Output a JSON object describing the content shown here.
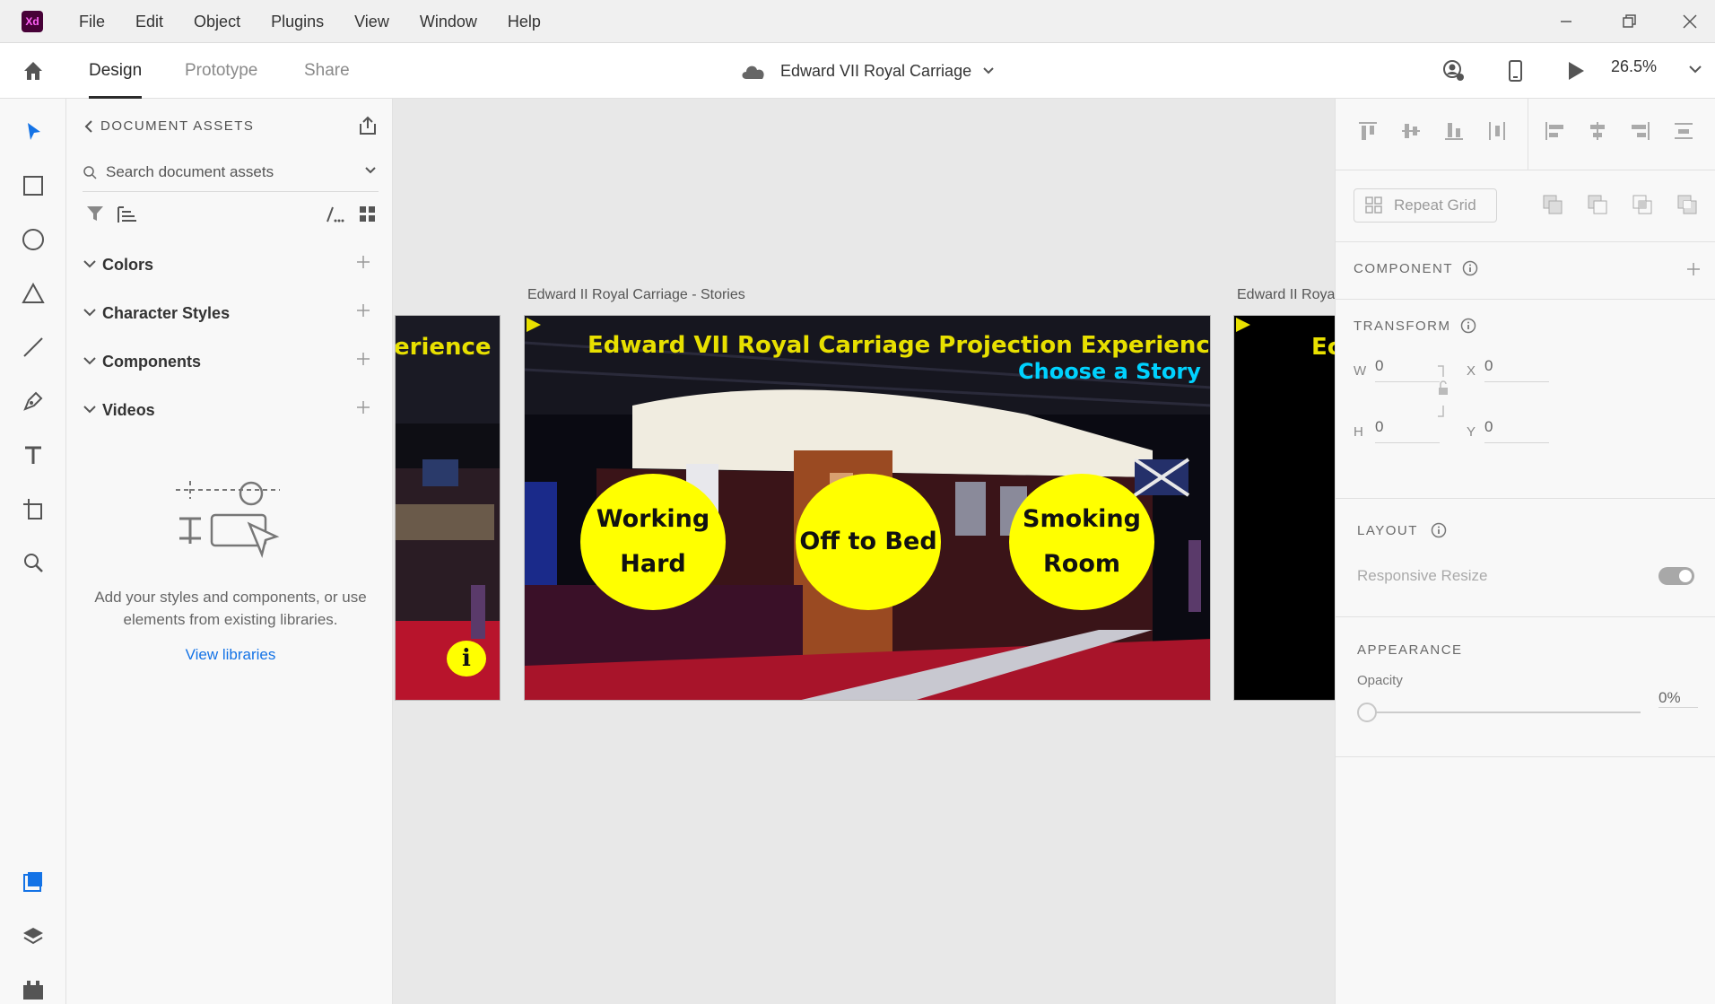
{
  "menu": {
    "app_logo": "Xd",
    "items": [
      "File",
      "Edit",
      "Object",
      "Plugins",
      "View",
      "Window",
      "Help"
    ]
  },
  "toolbar": {
    "tabs": [
      "Design",
      "Prototype",
      "Share"
    ],
    "active_tab": "Design",
    "doc_title": "Edward VII Royal Carriage",
    "zoom": "26.5%"
  },
  "assets": {
    "header": "DOCUMENT ASSETS",
    "search_placeholder": "Search document assets",
    "sections": [
      "Colors",
      "Character Styles",
      "Components",
      "Videos"
    ],
    "empty_message": "Add your styles and components, or use elements from existing libraries.",
    "view_libraries": "View libraries"
  },
  "canvas": {
    "left_artboard": {
      "title_fragment": "erience",
      "info_badge": "i"
    },
    "main_artboard": {
      "label": "Edward II Royal Carriage - Stories",
      "title": "Edward VII Royal Carriage Projection Experience",
      "subtitle": "Choose a Story",
      "circles": [
        "Working Hard",
        "Off to Bed",
        "Smoking Room"
      ]
    },
    "right_artboard": {
      "label": "Edward II Roya",
      "title_fragment": "Ec"
    }
  },
  "inspector": {
    "repeat_grid": "Repeat Grid",
    "component_label": "COMPONENT",
    "transform_label": "TRANSFORM",
    "fields": {
      "w": "0",
      "h": "0",
      "x": "0",
      "y": "0"
    },
    "field_labels": {
      "w": "W",
      "h": "H",
      "x": "X",
      "y": "Y"
    },
    "layout_label": "LAYOUT",
    "responsive_resize": "Responsive Resize",
    "appearance_label": "APPEARANCE",
    "opacity_label": "Opacity",
    "opacity_value": "0%"
  },
  "colors": {
    "accent_blue": "#1473e6",
    "circle_yellow": "#ffff00",
    "title_yellow": "#e8e000",
    "subtitle_cyan": "#00d2ff"
  }
}
